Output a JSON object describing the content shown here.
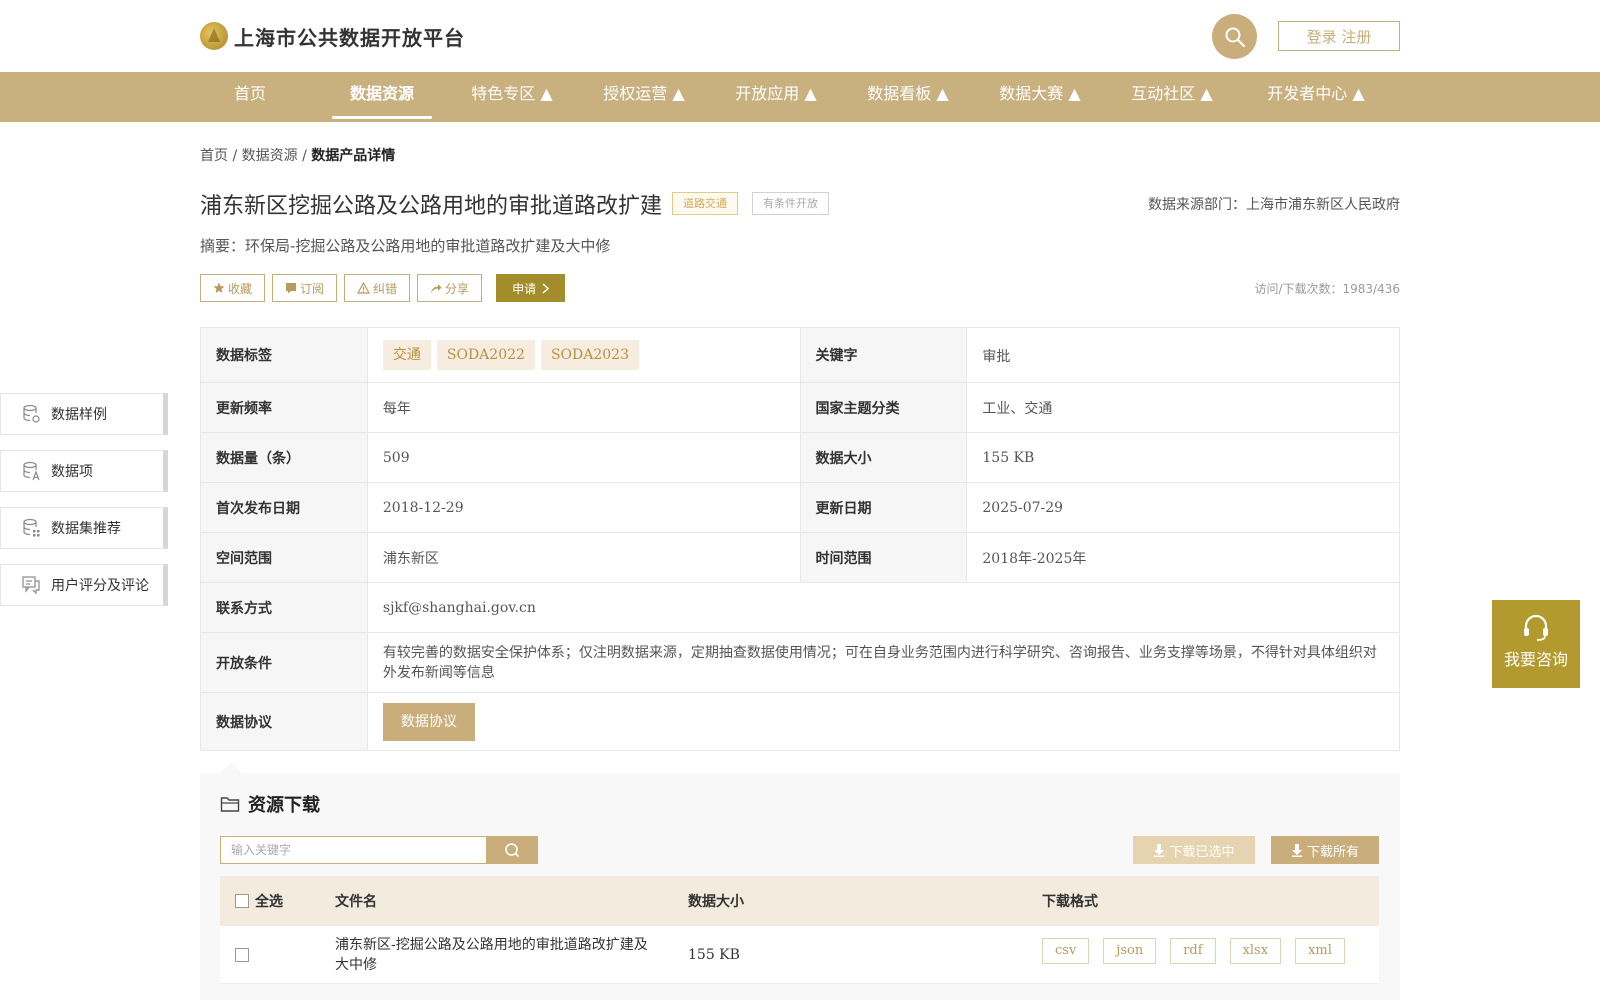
{
  "header": {
    "site_title": "上海市公共数据开放平台",
    "login_label": "登录 注册"
  },
  "nav": [
    {
      "label": "首页"
    },
    {
      "label": "数据资源"
    },
    {
      "label": "特色专区 ▲"
    },
    {
      "label": "授权运营 ▲"
    },
    {
      "label": "开放应用 ▲"
    },
    {
      "label": "数据看板 ▲"
    },
    {
      "label": "数据大赛 ▲"
    },
    {
      "label": "互动社区 ▲"
    },
    {
      "label": "开发者中心 ▲"
    }
  ],
  "breadcrumb": {
    "home": "首页",
    "sep1": " / ",
    "resources": "数据资源",
    "sep2": " / ",
    "current": "数据产品详情"
  },
  "detail": {
    "title": "浦东新区挖掘公路及公路用地的审批道路改扩建",
    "tag_category": "道路交通",
    "tag_open": "有条件开放",
    "source": "数据来源部门：上海市浦东新区人民政府",
    "summary": "摘要：环保局-挖掘公路及公路用地的审批道路改扩建及大中修",
    "visits": "访问/下载次数：1983/436"
  },
  "actions": {
    "favorite": "收藏",
    "subscribe": "订阅",
    "correct": "纠错",
    "share": "分享",
    "apply": "申请"
  },
  "info": {
    "tags_label": "数据标签",
    "tags": [
      "交通",
      "SODA2022",
      "SODA2023"
    ],
    "keyword_label": "关键字",
    "keyword": "审批",
    "freq_label": "更新频率",
    "freq": "每年",
    "theme_label": "国家主题分类",
    "theme": "工业、交通",
    "count_label": "数据量（条）",
    "count": "509",
    "size_label": "数据大小",
    "size": "155 KB",
    "first_pub_label": "首次发布日期",
    "first_pub": "2018-12-29",
    "update_label": "更新日期",
    "update": "2025-07-29",
    "space_label": "空间范围",
    "space": "浦东新区",
    "time_label": "时间范围",
    "time": "2018年-2025年",
    "contact_label": "联系方式",
    "contact": "sjkf@shanghai.gov.cn",
    "condition_label": "开放条件",
    "condition": "有较完善的数据安全保护体系；仅注明数据来源，定期抽查数据使用情况；可在自身业务范围内进行科学研究、咨询报告、业务支撑等场景，不得针对具体组织对外发布新闻等信息",
    "protocol_label": "数据协议",
    "protocol_btn": "数据协议"
  },
  "side_menu": [
    {
      "label": "数据样例",
      "icon": "database-sample-icon"
    },
    {
      "label": "数据项",
      "icon": "database-fields-icon"
    },
    {
      "label": "数据集推荐",
      "icon": "database-recommend-icon"
    },
    {
      "label": "用户评分及评论",
      "icon": "comment-icon"
    }
  ],
  "consult": {
    "label": "我要咨询"
  },
  "download": {
    "title": "资源下载",
    "search_placeholder": "输入关键字",
    "download_selected": "下载已选中",
    "download_all": "下载所有",
    "col_select_all": "全选",
    "col_filename": "文件名",
    "col_size": "数据大小",
    "col_format": "下载格式",
    "rows": [
      {
        "filename": "浦东新区-挖掘公路及公路用地的审批道路改扩建及大中修",
        "size": "155 KB",
        "formats": [
          "csv",
          "json",
          "rdf",
          "xlsx",
          "xml"
        ]
      }
    ]
  },
  "colors": {
    "brand_gold": "#c9b07f",
    "apply_olive": "#a38d2a",
    "consult_olive": "#b39a2e"
  }
}
